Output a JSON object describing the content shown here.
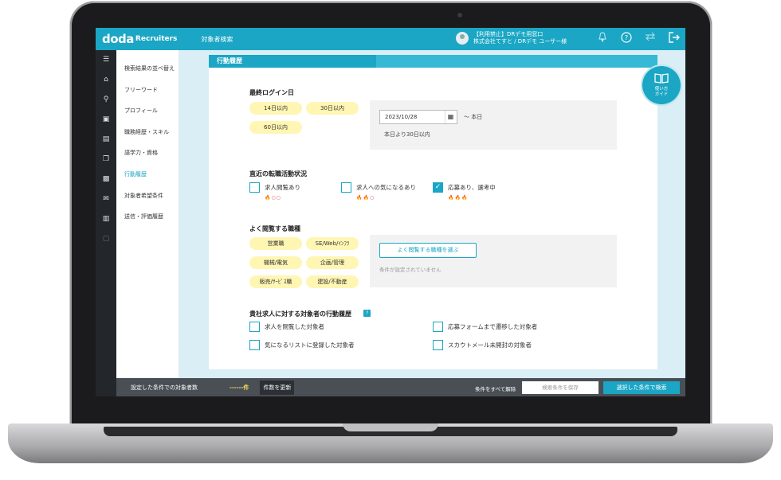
{
  "header": {
    "logo": "doda",
    "logo_sub": "Recruiters",
    "nav": "対象者検索",
    "user_line1": "【利用禁止】DRデモ用窓口",
    "user_line2": "株式会社てすと / DRデモ ユーザー様"
  },
  "side_menu": [
    "検索結果の並べ替え",
    "フリーワード",
    "プロフィール",
    "職務経歴・スキル",
    "語学力・資格",
    "行動履歴",
    "対象者希望条件",
    "送信・評価履歴"
  ],
  "panel": {
    "title": "行動履歴",
    "last_login": {
      "label": "最終ログイン日",
      "chips": [
        "14日以内",
        "30日以内",
        "60日以内"
      ],
      "date_value": "2023/10/28",
      "date_suffix": "～ 本日",
      "date_note": "本日より30日以内"
    },
    "job_activity": {
      "label": "直近の転職活動状況",
      "options": [
        {
          "label": "求人閲覧あり",
          "flames": "🔥○○",
          "checked": false
        },
        {
          "label": "求人への気になるあり",
          "flames": "🔥🔥○",
          "checked": false
        },
        {
          "label": "応募あり、選考中",
          "flames": "🔥🔥🔥",
          "checked": true
        }
      ]
    },
    "viewed_jobs": {
      "label": "よく閲覧する職種",
      "chips": [
        "営業職",
        "SE/Web/ｲﾝﾌﾗ",
        "機械/電気",
        "企画/管理",
        "販売/ｻｰﾋﾞｽ職",
        "建設/不動産"
      ],
      "select_button": "よく閲覧する職種を選ぶ",
      "empty_hint": "条件が設定されていません"
    },
    "company_history": {
      "label": "貴社求人に対する対象者の行動履歴",
      "help": "?",
      "options": [
        "求人を閲覧した対象者",
        "応募フォームまで遷移した対象者",
        "気になるリストに登録した対象者",
        "スカウトメール未開封の対象者"
      ]
    }
  },
  "guide": {
    "line1": "使い方",
    "line2": "ガイド"
  },
  "bottom": {
    "count_label": "設定した条件での対象者数",
    "count_value": "------件",
    "refresh": "件数を更新",
    "clear": "条件をすべて解除",
    "save": "検索条件を保存",
    "search": "選択した条件で検索"
  },
  "colors": {
    "accent": "#1aa6c4",
    "chip": "#fff6b3",
    "sidebar": "#23272b"
  }
}
